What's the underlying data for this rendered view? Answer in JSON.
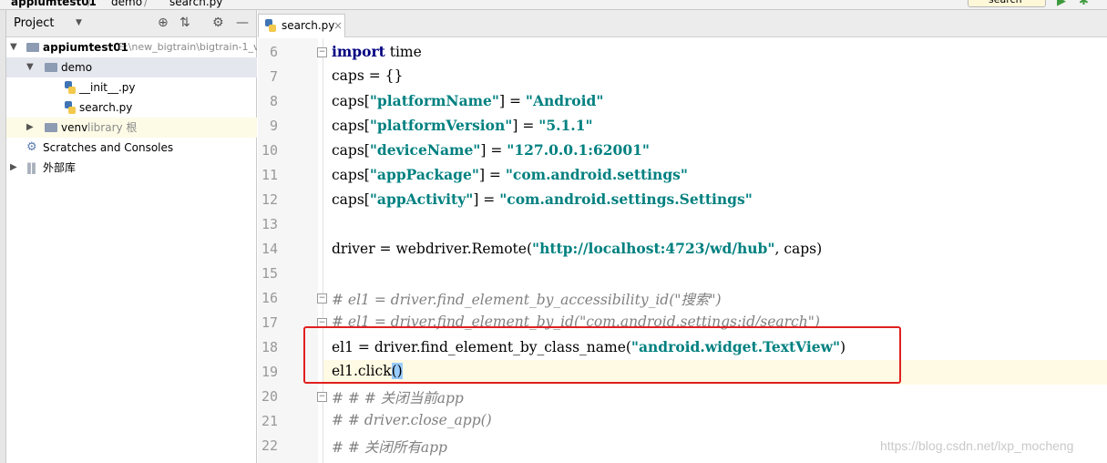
{
  "breadcrumb": {
    "project": "appiumtest01",
    "folder": "demo",
    "file": "search.py",
    "sep": "/"
  },
  "toolbar": {
    "search_label": "search"
  },
  "project_panel": {
    "title": "Project",
    "tree": {
      "root": {
        "name": "appiumtest01",
        "path": "E:\\new_bigtrain\\bigtrain-1_v"
      },
      "demo": "demo",
      "files": [
        "__init__.py",
        "search.py"
      ],
      "venv": {
        "name": "venv",
        "suffix": "library 根"
      },
      "scratches": "Scratches and Consoles",
      "external": "外部库"
    }
  },
  "editor": {
    "tab_label": "search.py",
    "close_glyph": "×",
    "line_numbers": [
      "6",
      "7",
      "8",
      "9",
      "10",
      "11",
      "12",
      "13",
      "14",
      "15",
      "16",
      "17",
      "18",
      "19",
      "20",
      "21",
      "22"
    ],
    "lines": {
      "l6": {
        "kw": "import",
        "rest": " time"
      },
      "l7": "caps = {}",
      "l8": {
        "pre": "caps[",
        "key": "\"platformName\"",
        "mid": "] = ",
        "val": "\"Android\""
      },
      "l9": {
        "pre": "caps[",
        "key": "\"platformVersion\"",
        "mid": "] = ",
        "val": "\"5.1.1\""
      },
      "l10": {
        "pre": "caps[",
        "key": "\"deviceName\"",
        "mid": "] = ",
        "val": "\"127.0.0.1:62001\""
      },
      "l11": {
        "pre": "caps[",
        "key": "\"appPackage\"",
        "mid": "] = ",
        "val": "\"com.android.settings\""
      },
      "l12": {
        "pre": "caps[",
        "key": "\"appActivity\"",
        "mid": "] = ",
        "val": "\"com.android.settings.Settings\""
      },
      "l14": {
        "pre": "driver = webdriver.Remote(",
        "url": "\"http://localhost:4723/wd/hub\"",
        "post": ", caps)"
      },
      "l16": "# el1 = driver.find_element_by_accessibility_id(\"搜索\")",
      "l17": "# el1 = driver.find_element_by_id(\"com.android.settings:id/search\")",
      "l18": {
        "pre": "el1 = driver.find_element_by_class_name(",
        "str": "\"android.widget.TextView\"",
        "post": ")"
      },
      "l19": {
        "pre": "el1.click",
        "brace": "()"
      },
      "l20": "# # # 关闭当前app",
      "l21": "# # driver.close_app()",
      "l22": "# # 关闭所有app"
    }
  },
  "watermark": "https://blog.csdn.net/lxp_mocheng",
  "colors": {
    "keyword": "#000080",
    "string": "#008080",
    "comment": "#808080",
    "annotation_box": "#e02020",
    "current_line": "#fffae3"
  }
}
